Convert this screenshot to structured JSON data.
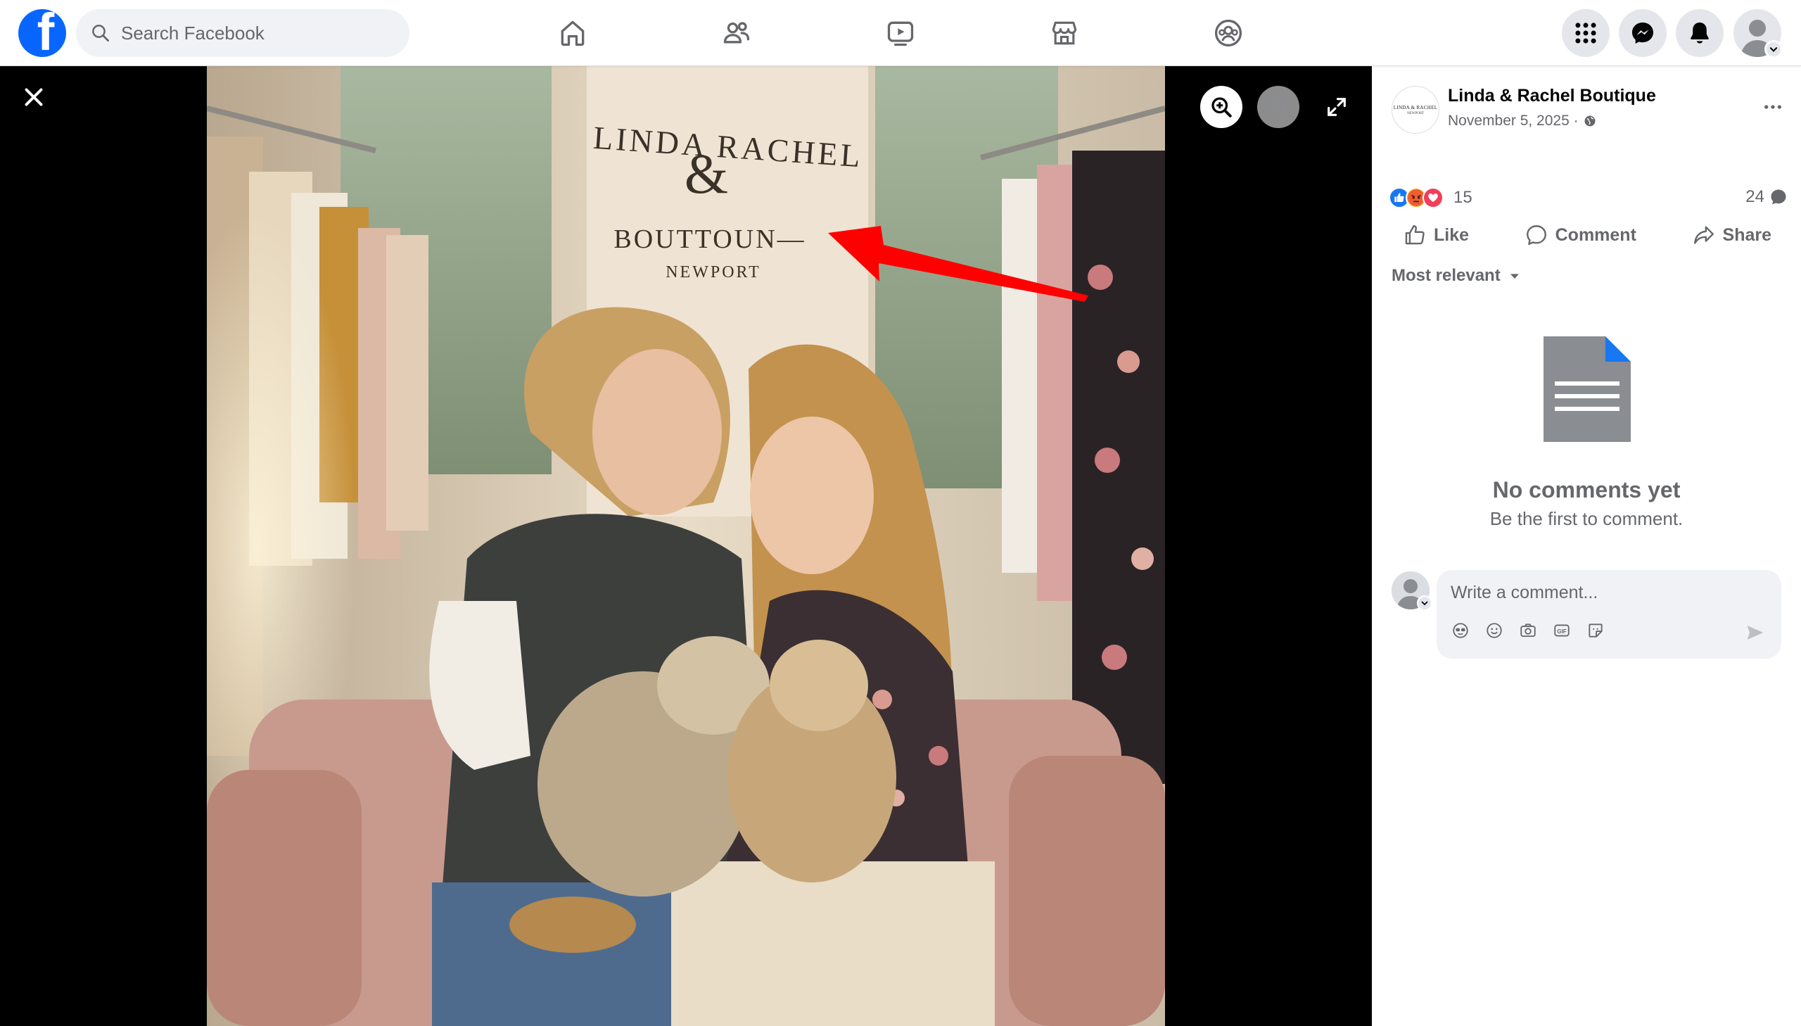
{
  "topbar": {
    "logo_letter": "f",
    "search_placeholder": "Search Facebook",
    "nav": [
      "home-icon",
      "friends-icon",
      "video-icon",
      "marketplace-icon",
      "groups-icon"
    ],
    "right_buttons": [
      "menu-grid-icon",
      "messenger-icon",
      "notifications-icon",
      "account-avatar"
    ]
  },
  "viewer": {
    "photo_sign": {
      "line1": "LINDA RACHEL",
      "line2": "&",
      "line3": "BOUTTOUN—",
      "line4": "NEWPORT"
    },
    "controls": [
      "close-icon",
      "zoom-in-icon",
      "zoom-out-icon",
      "fullscreen-icon"
    ],
    "annotation_color": "#ff0000"
  },
  "post": {
    "page_name": "Linda & Rachel Boutique",
    "avatar_text_line1": "LINDA & RACHEL",
    "avatar_text_line2": "NEWPORT",
    "date": "November 5, 2025 ·",
    "reaction_count": "15",
    "comment_count": "24",
    "actions": {
      "like": "Like",
      "comment": "Comment",
      "share": "Share"
    },
    "sort_label": "Most relevant",
    "empty_title": "No comments yet",
    "empty_subtitle": "Be the first to comment.",
    "comment_placeholder": "Write a comment..."
  },
  "colors": {
    "brand_blue": "#0866ff",
    "like_blue": "#1877f2",
    "love_red": "#f33e58",
    "angry_yellow": "#f7b125",
    "muted_text": "#65676b",
    "input_bg": "#f0f2f5"
  }
}
